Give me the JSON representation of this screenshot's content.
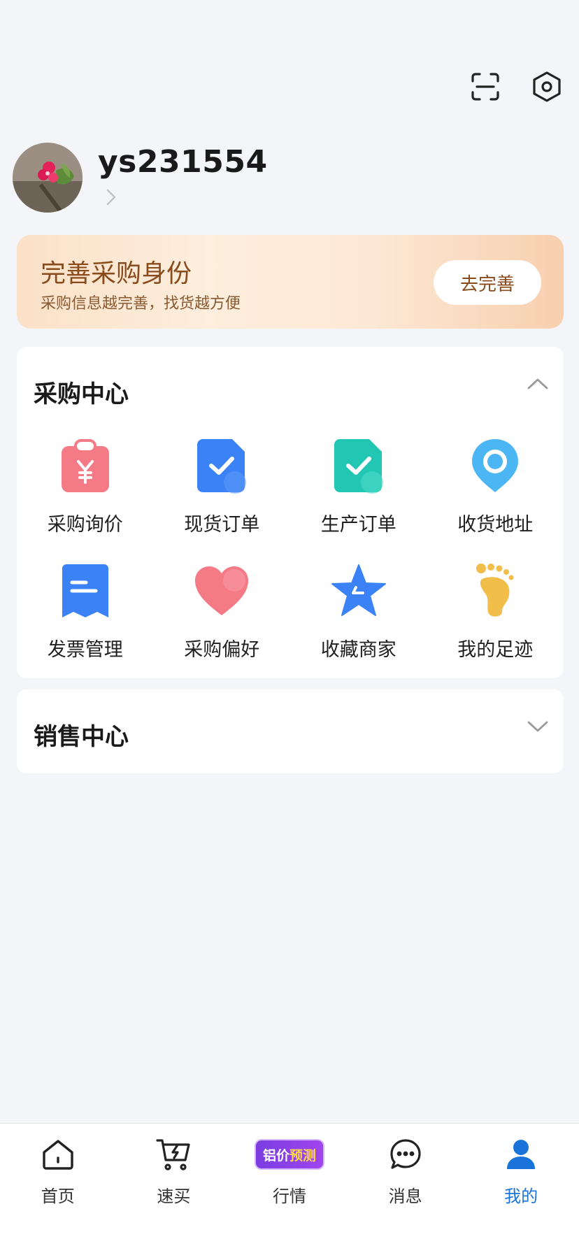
{
  "profile": {
    "username": "ys231554"
  },
  "banner": {
    "title": "完善采购身份",
    "subtitle": "采购信息越完善，找货越方便",
    "button": "去完善"
  },
  "purchase_center": {
    "title": "采购中心",
    "items": [
      {
        "label": "采购询价",
        "icon": "inquiry-clipboard-icon"
      },
      {
        "label": "现货订单",
        "icon": "spot-order-icon"
      },
      {
        "label": "生产订单",
        "icon": "production-order-icon"
      },
      {
        "label": "收货地址",
        "icon": "location-pin-icon"
      },
      {
        "label": "发票管理",
        "icon": "invoice-icon"
      },
      {
        "label": "采购偏好",
        "icon": "heart-icon"
      },
      {
        "label": "收藏商家",
        "icon": "star-icon"
      },
      {
        "label": "我的足迹",
        "icon": "footprint-icon"
      }
    ]
  },
  "sales_center": {
    "title": "销售中心"
  },
  "tabbar": {
    "items": [
      {
        "label": "首页",
        "icon": "home-icon"
      },
      {
        "label": "速买",
        "icon": "cart-icon"
      },
      {
        "label": "行情",
        "icon": "price-forecast-badge"
      },
      {
        "label": "消息",
        "icon": "chat-icon"
      },
      {
        "label": "我的",
        "icon": "user-icon",
        "active": true
      }
    ],
    "badge": {
      "text_left": "铝价",
      "text_right": "预测"
    }
  },
  "colors": {
    "accent": "#1a73d8",
    "banner_text": "#8a4b1c"
  }
}
